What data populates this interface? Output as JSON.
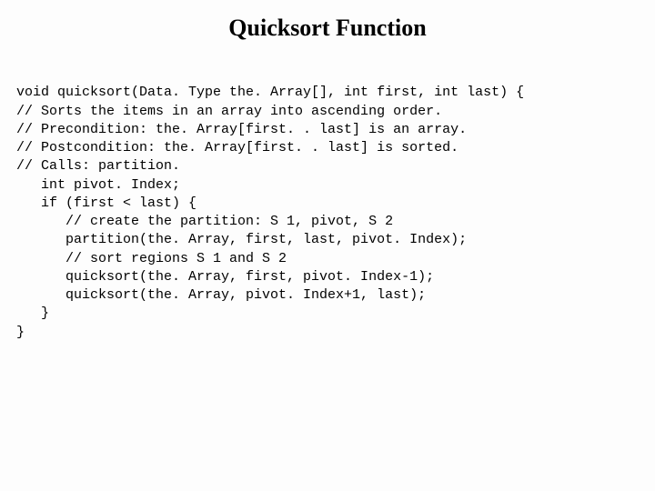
{
  "title": "Quicksort Function",
  "code": {
    "l0": "void quicksort(Data. Type the. Array[], int first, int last) {",
    "l1": "// Sorts the items in an array into ascending order.",
    "l2": "// Precondition: the. Array[first. . last] is an array.",
    "l3": "// Postcondition: the. Array[first. . last] is sorted.",
    "l4": "// Calls: partition.",
    "l5": "   int pivot. Index;",
    "l6": "   if (first < last) {",
    "l7": "      // create the partition: S 1, pivot, S 2",
    "l8": "      partition(the. Array, first, last, pivot. Index);",
    "l9": "      // sort regions S 1 and S 2",
    "l10": "      quicksort(the. Array, first, pivot. Index-1);",
    "l11": "      quicksort(the. Array, pivot. Index+1, last);",
    "l12": "   }",
    "l13": "}"
  }
}
